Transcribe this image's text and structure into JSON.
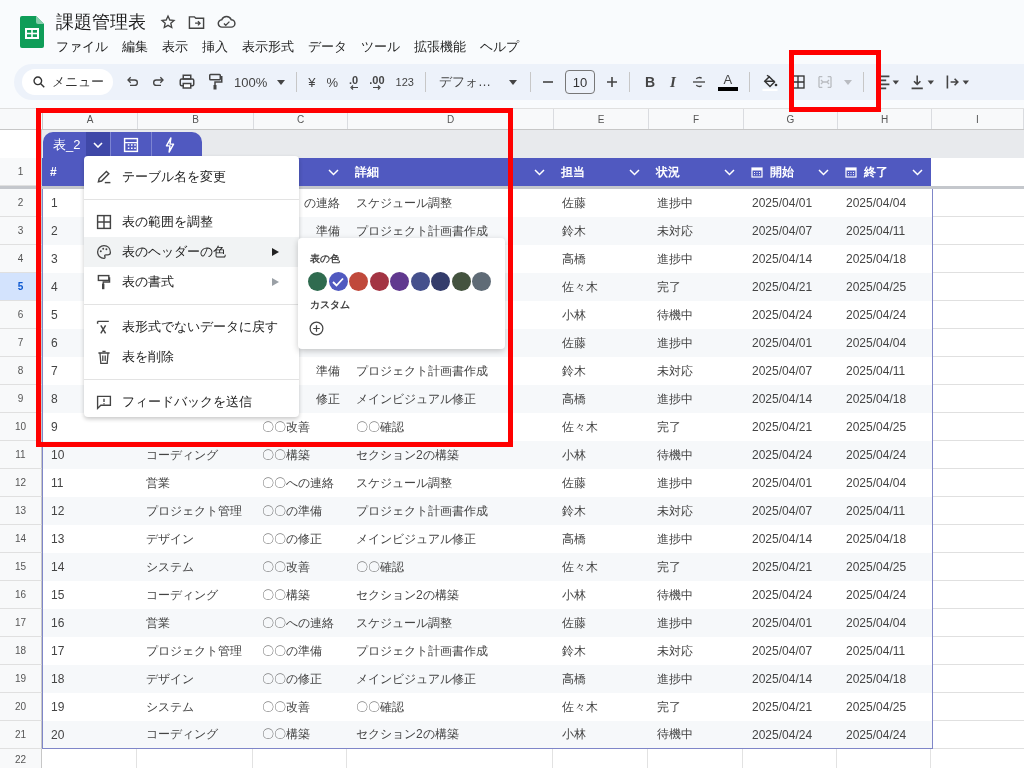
{
  "document": {
    "title": "課題管理表"
  },
  "menu_bar": [
    "ファイル",
    "編集",
    "表示",
    "挿入",
    "表示形式",
    "データ",
    "ツール",
    "拡張機能",
    "ヘルプ"
  ],
  "toolbar": {
    "search": "メニュー",
    "zoom": "100%",
    "currency": "¥",
    "percent": "%",
    "decrease_decimal": ".0",
    "increase_decimal": ".00",
    "number_format": "123",
    "font": "デフォ…",
    "font_size": "10",
    "bold": "B",
    "italic": "I",
    "text_color": "A",
    "merge_disabled": true
  },
  "column_letters": [
    "A",
    "B",
    "C",
    "D",
    "E",
    "F",
    "G",
    "H",
    "I"
  ],
  "row_numbers": [
    {
      "label": "1",
      "selected": false
    },
    {
      "label": "2",
      "selected": false
    },
    {
      "label": "3",
      "selected": false
    },
    {
      "label": "4",
      "selected": false
    },
    {
      "label": "5",
      "selected": true
    },
    {
      "label": "6",
      "selected": false
    },
    {
      "label": "7",
      "selected": false
    },
    {
      "label": "8",
      "selected": false
    },
    {
      "label": "9",
      "selected": false
    },
    {
      "label": "10",
      "selected": false
    },
    {
      "label": "11",
      "selected": false
    },
    {
      "label": "12",
      "selected": false
    },
    {
      "label": "13",
      "selected": false
    },
    {
      "label": "14",
      "selected": false
    },
    {
      "label": "15",
      "selected": false
    },
    {
      "label": "16",
      "selected": false
    },
    {
      "label": "17",
      "selected": false
    },
    {
      "label": "18",
      "selected": false
    },
    {
      "label": "19",
      "selected": false
    },
    {
      "label": "20",
      "selected": false
    },
    {
      "label": "21",
      "selected": false
    },
    {
      "label": "22",
      "selected": false
    }
  ],
  "table": {
    "name": "表_2",
    "columns": [
      {
        "label": "#",
        "kind": "text"
      },
      null,
      {
        "kind": "text",
        "chevron": true
      },
      {
        "label": "詳細",
        "kind": "text",
        "chevron": true
      },
      {
        "label": "担当",
        "kind": "text",
        "chevron": true
      },
      {
        "label": "状況",
        "kind": "text",
        "chevron": true
      },
      {
        "label": "開始",
        "kind": "date",
        "chevron": true
      },
      {
        "label": "終了",
        "kind": "date",
        "chevron": true
      }
    ],
    "rows": [
      [
        "1",
        null,
        {
          "text": "の連絡",
          "cut": true
        },
        "スケジュール調整",
        "佐藤",
        "進捗中",
        "2025/04/01",
        "2025/04/04"
      ],
      [
        "2",
        null,
        {
          "text": "準備",
          "cut": true
        },
        "プロジェクト計画書作成",
        "鈴木",
        "未対応",
        "2025/04/07",
        "2025/04/11"
      ],
      [
        "3",
        null,
        null,
        null,
        "高橋",
        "進捗中",
        "2025/04/14",
        "2025/04/18"
      ],
      [
        "4",
        null,
        null,
        null,
        "佐々木",
        "完了",
        "2025/04/21",
        "2025/04/25"
      ],
      [
        "5",
        null,
        null,
        null,
        "小林",
        "待機中",
        "2025/04/24",
        "2025/04/24"
      ],
      [
        "6",
        null,
        null,
        null,
        "佐藤",
        "進捗中",
        "2025/04/01",
        "2025/04/04"
      ],
      [
        "7",
        null,
        {
          "text": "準備",
          "cut": true
        },
        "プロジェクト計画書作成",
        "鈴木",
        "未対応",
        "2025/04/07",
        "2025/04/11"
      ],
      [
        "8",
        null,
        {
          "text": "修正",
          "cut": true
        },
        "メインビジュアル修正",
        "高橋",
        "進捗中",
        "2025/04/14",
        "2025/04/18"
      ],
      [
        "9",
        null,
        "〇〇改善",
        "〇〇確認",
        "佐々木",
        "完了",
        "2025/04/21",
        "2025/04/25"
      ],
      [
        "10",
        "コーディング",
        "〇〇構築",
        "セクション2の構築",
        "小林",
        "待機中",
        "2025/04/24",
        "2025/04/24"
      ],
      [
        "11",
        "営業",
        "〇〇への連絡",
        "スケジュール調整",
        "佐藤",
        "進捗中",
        "2025/04/01",
        "2025/04/04"
      ],
      [
        "12",
        "プロジェクト管理",
        "〇〇の準備",
        "プロジェクト計画書作成",
        "鈴木",
        "未対応",
        "2025/04/07",
        "2025/04/11"
      ],
      [
        "13",
        "デザイン",
        "〇〇の修正",
        "メインビジュアル修正",
        "高橋",
        "進捗中",
        "2025/04/14",
        "2025/04/18"
      ],
      [
        "14",
        "システム",
        "〇〇改善",
        "〇〇確認",
        "佐々木",
        "完了",
        "2025/04/21",
        "2025/04/25"
      ],
      [
        "15",
        "コーディング",
        "〇〇構築",
        "セクション2の構築",
        "小林",
        "待機中",
        "2025/04/24",
        "2025/04/24"
      ],
      [
        "16",
        "営業",
        "〇〇への連絡",
        "スケジュール調整",
        "佐藤",
        "進捗中",
        "2025/04/01",
        "2025/04/04"
      ],
      [
        "17",
        "プロジェクト管理",
        "〇〇の準備",
        "プロジェクト計画書作成",
        "鈴木",
        "未対応",
        "2025/04/07",
        "2025/04/11"
      ],
      [
        "18",
        "デザイン",
        "〇〇の修正",
        "メインビジュアル修正",
        "高橋",
        "進捗中",
        "2025/04/14",
        "2025/04/18"
      ],
      [
        "19",
        "システム",
        "〇〇改善",
        "〇〇確認",
        "佐々木",
        "完了",
        "2025/04/21",
        "2025/04/25"
      ],
      [
        "20",
        "コーディング",
        "〇〇構築",
        "セクション2の構築",
        "小林",
        "待機中",
        "2025/04/24",
        "2025/04/24"
      ]
    ]
  },
  "context_menu": {
    "items": [
      {
        "kind": "item",
        "label": "テーブル名を変更",
        "submenu": false,
        "selected": false
      },
      {
        "kind": "separator"
      },
      {
        "kind": "item",
        "label": "表の範囲を調整",
        "submenu": false,
        "selected": false
      },
      {
        "kind": "item",
        "label": "表のヘッダーの色",
        "submenu": true,
        "selected": true
      },
      {
        "kind": "item",
        "label": "表の書式",
        "submenu": true,
        "selected": false
      },
      {
        "kind": "separator"
      },
      {
        "kind": "item",
        "label": "表形式でないデータに戻す",
        "submenu": false,
        "selected": false
      },
      {
        "kind": "item",
        "label": "表を削除",
        "submenu": false,
        "selected": false
      },
      {
        "kind": "separator"
      },
      {
        "kind": "item",
        "label": "フィードバックを送信",
        "submenu": false,
        "selected": false
      }
    ]
  },
  "submenu": {
    "title": "表の色",
    "custom_label": "カスタム",
    "swatches": [
      {
        "color": "#2f6b4f",
        "selected": false
      },
      {
        "color": "#5059c0",
        "selected": true
      },
      {
        "color": "#c0493b",
        "selected": false
      },
      {
        "color": "#a33443",
        "selected": false
      },
      {
        "color": "#61398f",
        "selected": false
      },
      {
        "color": "#45508c",
        "selected": false
      },
      {
        "color": "#333c6b",
        "selected": false
      },
      {
        "color": "#44533f",
        "selected": false
      },
      {
        "color": "#5f6b76",
        "selected": false
      }
    ]
  }
}
